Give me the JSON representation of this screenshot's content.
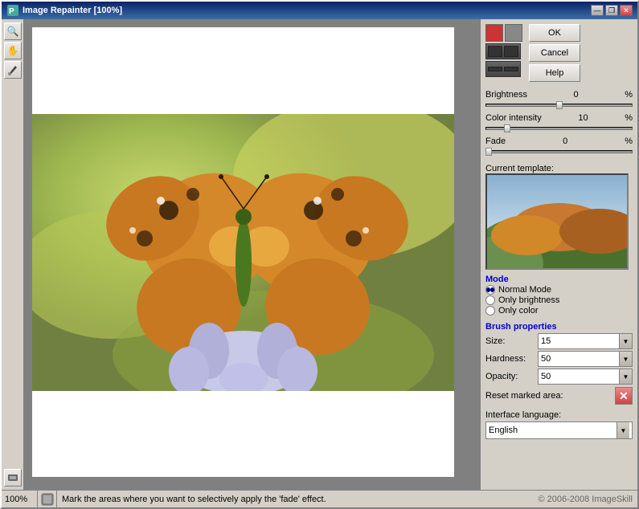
{
  "window": {
    "title": "Image Repainter [100%]",
    "zoom": "100%"
  },
  "title_controls": {
    "minimize": "—",
    "restore": "❐",
    "close": "✕"
  },
  "tools": [
    "🔍",
    "✋",
    "✏"
  ],
  "buttons": {
    "ok": "OK",
    "cancel": "Cancel",
    "help": "Help"
  },
  "sliders": {
    "brightness": {
      "label": "Brightness",
      "value": "0",
      "pct": "%"
    },
    "color_intensity": {
      "label": "Color intensity",
      "value": "10",
      "pct": "%"
    },
    "fade": {
      "label": "Fade",
      "value": "0",
      "pct": "%"
    }
  },
  "template": {
    "label": "Current template:"
  },
  "mode": {
    "title": "Mode",
    "options": [
      {
        "label": "Normal Mode",
        "selected": true
      },
      {
        "label": "Only brightness",
        "selected": false
      },
      {
        "label": "Only color",
        "selected": false
      }
    ]
  },
  "brush": {
    "title": "Brush properties",
    "size_label": "Size:",
    "size_value": "15",
    "hardness_label": "Hardness:",
    "hardness_value": "50",
    "opacity_label": "Opacity:",
    "opacity_value": "50",
    "reset_label": "Reset marked area:",
    "reset_icon": "✕"
  },
  "language": {
    "label": "Interface language:",
    "value": "English"
  },
  "status": {
    "zoom": "100%",
    "message": "Mark the areas where you want to selectively apply the 'fade' effect.",
    "credit": "© 2006-2008 ImageSkill"
  }
}
